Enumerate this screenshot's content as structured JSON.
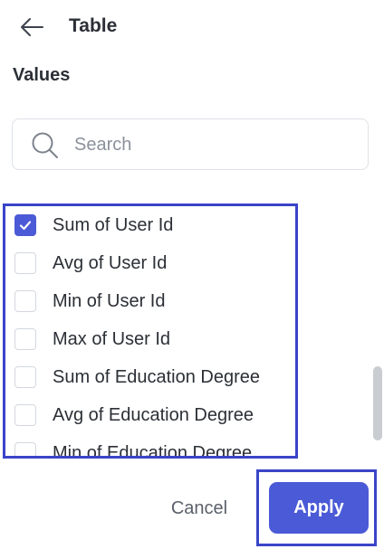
{
  "header": {
    "title": "Table",
    "back_icon": "arrow-left-icon"
  },
  "section": {
    "title": "Values"
  },
  "search": {
    "placeholder": "Search",
    "value": "",
    "icon": "search-icon"
  },
  "list": {
    "items": [
      {
        "label": "Sum of User Id",
        "checked": true
      },
      {
        "label": "Avg of User Id",
        "checked": false
      },
      {
        "label": "Min of User Id",
        "checked": false
      },
      {
        "label": "Max of User Id",
        "checked": false
      },
      {
        "label": "Sum of Education Degree",
        "checked": false
      },
      {
        "label": "Avg of Education Degree",
        "checked": false
      },
      {
        "label": "Min of Education Degree",
        "checked": false
      }
    ]
  },
  "footer": {
    "cancel_label": "Cancel",
    "apply_label": "Apply"
  },
  "colors": {
    "accent": "#4b5ad6",
    "highlight_border": "#3a44c8",
    "text": "#2b2f36",
    "muted_text": "#5a606a"
  }
}
